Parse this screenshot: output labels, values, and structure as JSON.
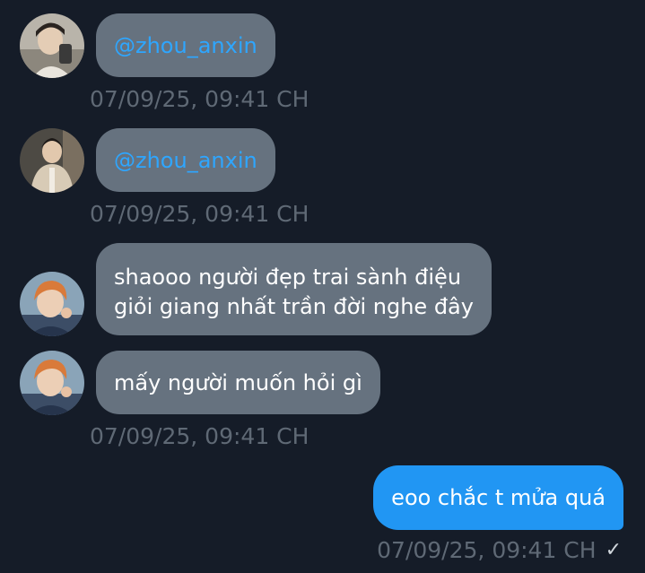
{
  "messages": [
    {
      "text": "@zhou_anxin",
      "timestamp": "07/09/25, 09:41 CH"
    },
    {
      "text": "@zhou_anxin",
      "timestamp": "07/09/25, 09:41 CH"
    },
    {
      "lines": [
        "shaooo người đẹp trai sành điệu",
        "giỏi giang nhất trần đời nghe đây"
      ]
    },
    {
      "text": "mấy người muốn hỏi gì",
      "timestamp": "07/09/25, 09:41 CH"
    }
  ],
  "outgoing": {
    "text": "eoo chắc t mửa quá",
    "timestamp": "07/09/25, 09:41 CH",
    "status_icon": "check-icon"
  },
  "colors": {
    "background": "#151c28",
    "incoming_bubble": "#66727f",
    "outgoing_bubble": "#2196f3",
    "mention": "#2ea6ff",
    "timestamp": "#5f6975"
  }
}
